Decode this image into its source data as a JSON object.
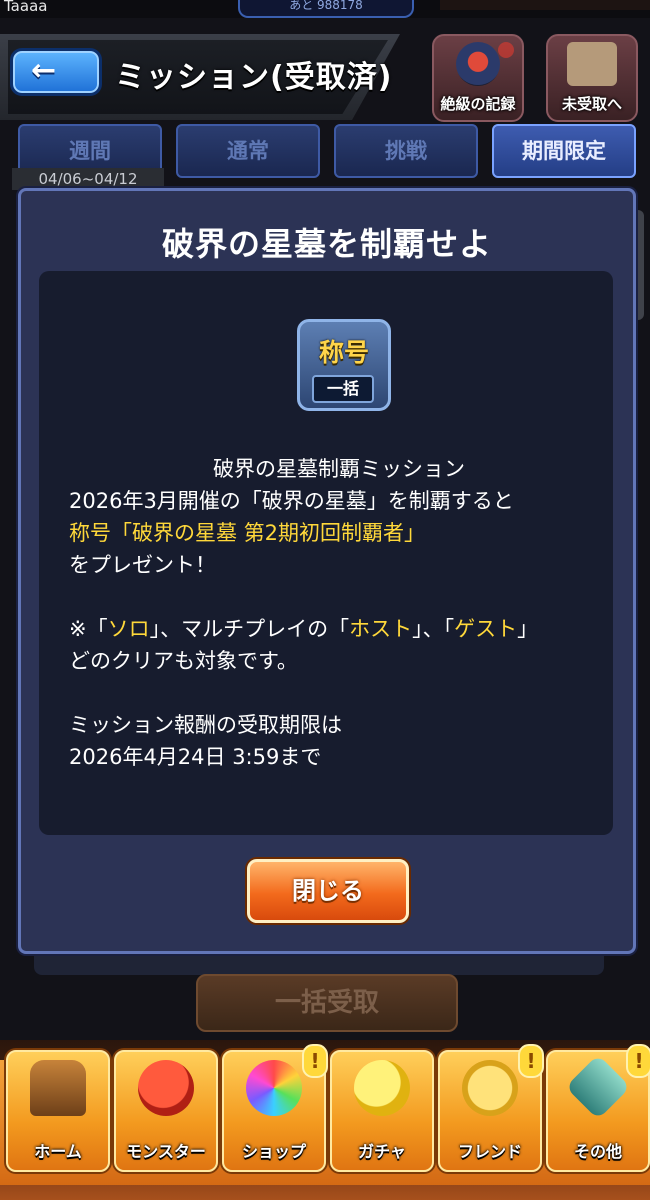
{
  "status_bar": {
    "username": "Taaaa",
    "points_text": "あと 988178"
  },
  "header": {
    "back_icon": "←",
    "title": "ミッション(受取済)",
    "record_label": "絶級の記録",
    "unclaimed_label": "未受取へ"
  },
  "tabs": [
    {
      "label": "週間",
      "active": false
    },
    {
      "label": "通常",
      "active": false
    },
    {
      "label": "挑戦",
      "active": false
    },
    {
      "label": "期間限定",
      "active": true
    }
  ],
  "date_range": "04/06~04/12",
  "dialog": {
    "title": "破界の星墓を制覇せよ",
    "badge_text": "称号",
    "badge_sub": "一括",
    "line1": "破界の星墓制覇ミッション",
    "line2": "2026年3月開催の「破界の星墓」を制覇すると",
    "line3": "称号「破界の星墓 第2期初回制覇者」",
    "line4": "をプレゼント！",
    "line5_a": "※「",
    "line5_solo": "ソロ",
    "line5_b": "」、マルチプレイの「",
    "line5_host": "ホスト",
    "line5_c": "」、「",
    "line5_guest": "ゲスト",
    "line5_d": "」",
    "line6": "どのクリアも対象です。",
    "line7": "ミッション報酬の受取期限は",
    "line8": "2026年4月24日 3:59まで",
    "close_label": "閉じる"
  },
  "background": {
    "claim_all_label": "一括受取"
  },
  "bottom_nav": [
    {
      "label": "ホーム",
      "icon": "home-icon"
    },
    {
      "label": "モンスター",
      "icon": "monster-icon"
    },
    {
      "label": "ショップ",
      "icon": "shop-icon"
    },
    {
      "label": "ガチャ",
      "icon": "gacha-icon"
    },
    {
      "label": "フレンド",
      "icon": "friend-icon"
    },
    {
      "label": "その他",
      "icon": "other-icon"
    }
  ],
  "alert_mark": "!"
}
